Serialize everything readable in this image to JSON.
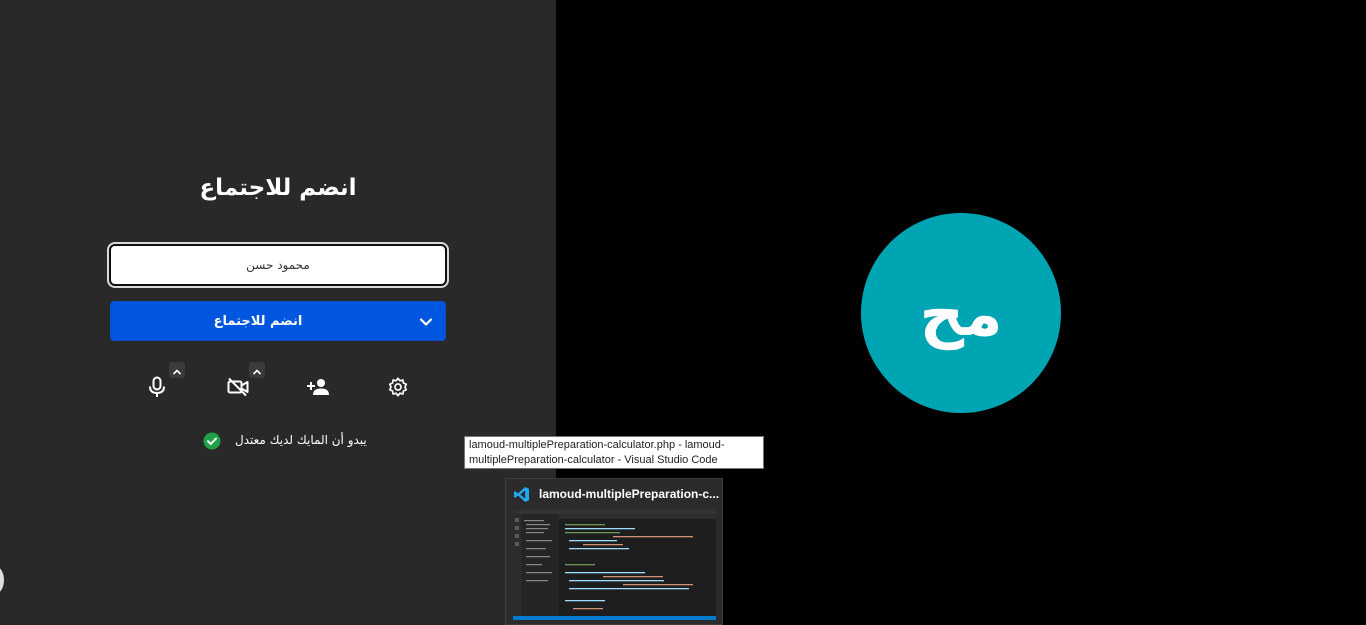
{
  "prejoin": {
    "title": "انضم للاجتماع",
    "name_input": {
      "value": "محمود حسن",
      "placeholder": ""
    },
    "join_button": {
      "label": "انضم للاجتماع",
      "icon": "chevron-down-icon"
    },
    "toolbar": [
      {
        "name": "microphone",
        "icon": "microphone-icon",
        "has_options": true
      },
      {
        "name": "camera",
        "icon": "camera-off-icon",
        "has_options": true
      },
      {
        "name": "invite",
        "icon": "add-person-icon",
        "has_options": false
      },
      {
        "name": "settings",
        "icon": "gear-icon",
        "has_options": false
      }
    ],
    "status": {
      "icon": "check-circle-icon",
      "text": "يبدو أن المايك لديك معتدل",
      "color": "#21a04a"
    }
  },
  "video": {
    "avatar_initials": "مح",
    "avatar_color": "#00a5b4"
  },
  "taskbar_preview": {
    "tooltip": "lamoud-multiplePreparation-calculator.php - lamoud-multiplePreparation-calculator - Visual Studio Code",
    "title": "lamoud-multiplePreparation-c...",
    "app_icon": "vscode-icon"
  },
  "colors": {
    "panel": "#292929",
    "video_bg": "#000000",
    "primary": "#0156e0"
  }
}
